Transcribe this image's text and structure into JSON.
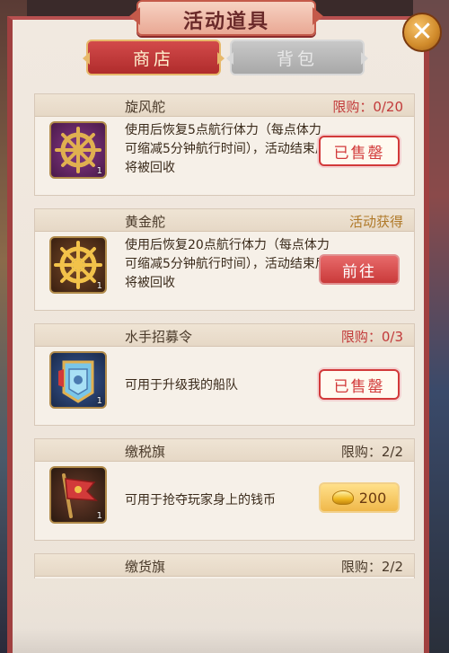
{
  "window": {
    "title": "活动道具"
  },
  "tabs": [
    {
      "label": "商店",
      "active": true
    },
    {
      "label": "背包",
      "active": false
    }
  ],
  "items": [
    {
      "name": "旋风舵",
      "limit": "限购：0/20",
      "count": "1",
      "description": "使用后恢复5点航行体力（每点体力可缩减5分钟航行时间），活动结束后将被回收",
      "button": "已售罄",
      "icon": "ship-wheel-icon"
    },
    {
      "name": "黄金舵",
      "limit": "活动获得",
      "count": "1",
      "description": "使用后恢复20点航行体力（每点体力可缩减5分钟航行时间），活动结束后将被回收",
      "button": "前往",
      "icon": "golden-wheel-icon"
    },
    {
      "name": "水手招募令",
      "limit": "限购：0/3",
      "count": "1",
      "description": "可用于升级我的船队",
      "button": "已售罄",
      "icon": "recruit-token-icon"
    },
    {
      "name": "缴税旗",
      "limit": "限购：2/2",
      "count": "1",
      "description": "可用于抢夺玩家身上的钱币",
      "price": "200",
      "icon": "tax-flag-icon"
    },
    {
      "name": "缴货旗",
      "limit": "限购：2/2"
    }
  ],
  "colors": {
    "accent": "#c23a3a",
    "panel": "#f1e9e0",
    "gold": "#f0b84a"
  }
}
